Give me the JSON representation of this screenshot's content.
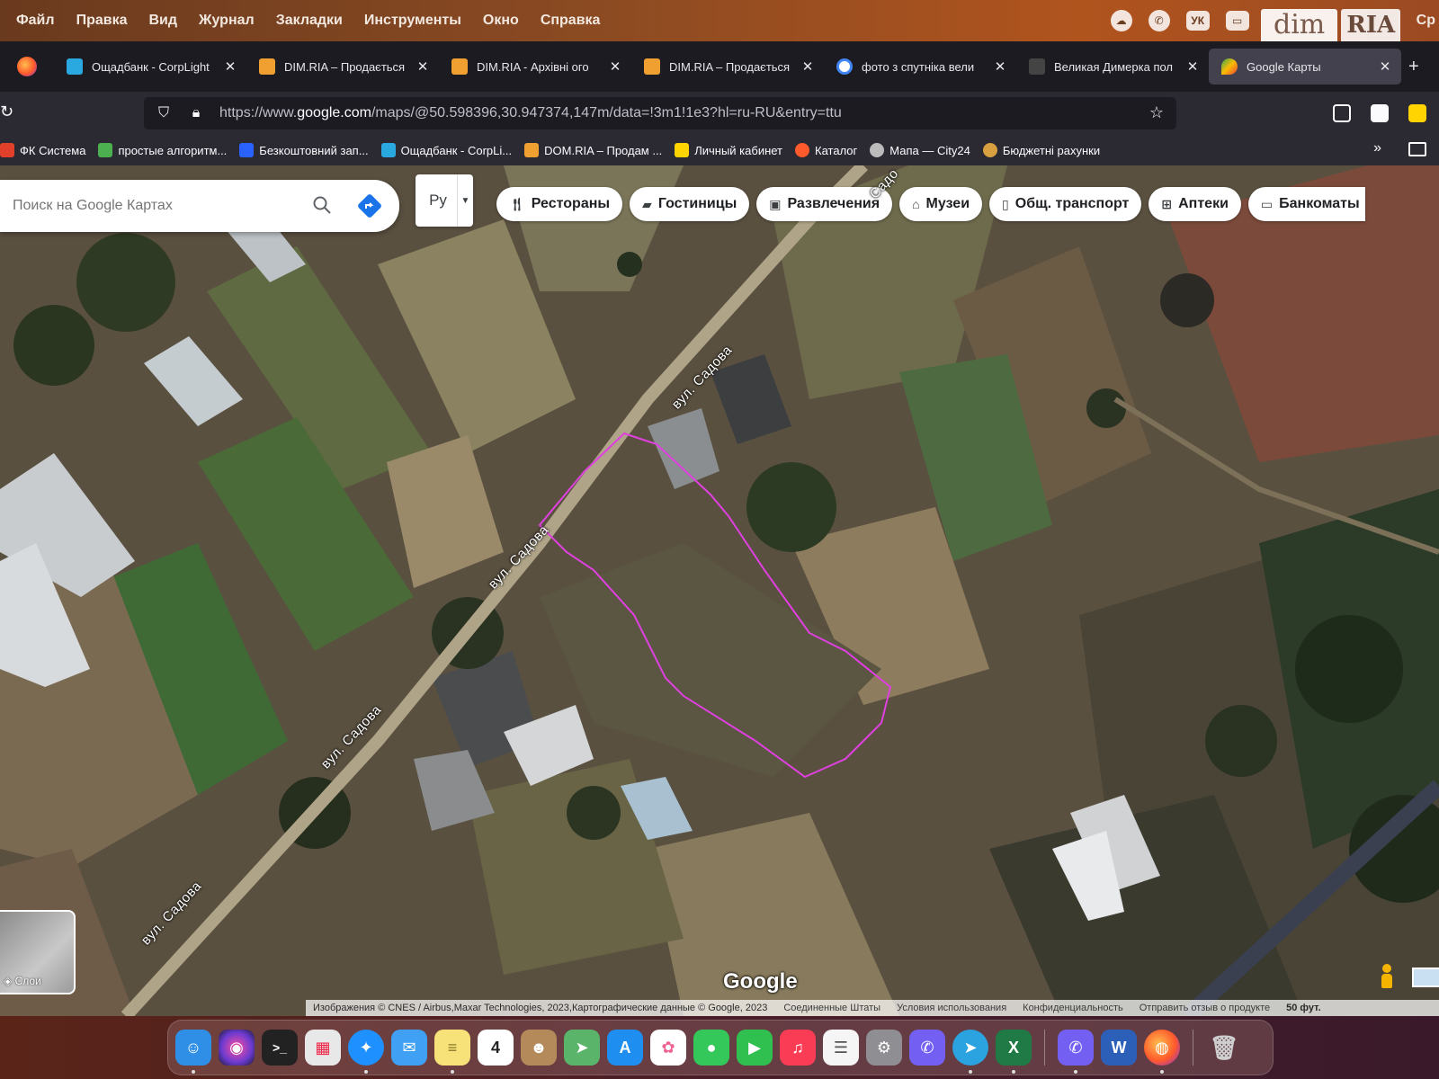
{
  "menubar": {
    "items": [
      "Файл",
      "Правка",
      "Вид",
      "Журнал",
      "Закладки",
      "Инструменты",
      "Окно",
      "Справка"
    ],
    "input_indicator": "УК",
    "clock": "Ср",
    "watermark": "dim RIA"
  },
  "tabs": [
    {
      "title": "Ощадбанк - CorpLight",
      "favicon_color": "#2aa8e0",
      "icon": "oschadbank-icon"
    },
    {
      "title": "DIM.RIA – Продається",
      "favicon_color": "#f0a030",
      "icon": "dimria-icon"
    },
    {
      "title": "DIM.RIA - Архівні ого",
      "favicon_color": "#f0a030",
      "icon": "dimria-icon"
    },
    {
      "title": "DIM.RIA – Продається",
      "favicon_color": "#f0a030",
      "icon": "dimria-icon"
    },
    {
      "title": "фото з спутніка вели",
      "favicon_color": "#ffffff",
      "icon": "google-icon"
    },
    {
      "title": "Великая Димерка пол",
      "favicon_color": "#444444",
      "icon": "building-icon"
    },
    {
      "title": "Google Карты",
      "favicon_color": "#34a853",
      "icon": "google-maps-icon",
      "active": true
    }
  ],
  "urlbar": {
    "url_prefix": "https://www.",
    "url_domain": "google.com",
    "url_rest": "/maps/@50.598396,30.947374,147m/data=!3m1!1e3?hl=ru-RU&entry=ttu"
  },
  "bookmarks": [
    {
      "label": "ФК Система",
      "color": "#e2402b"
    },
    {
      "label": "простые алгоритм...",
      "color": "#4caf50"
    },
    {
      "label": "Безкоштовний зап...",
      "color": "#2962ff"
    },
    {
      "label": "Ощадбанк - CorpLi...",
      "color": "#2aa8e0"
    },
    {
      "label": "DOM.RIA – Продам ...",
      "color": "#f0a030"
    },
    {
      "label": "Личный кабинет",
      "color": "#ffd400"
    },
    {
      "label": "Каталог",
      "color": "#ff5a2b"
    },
    {
      "label": "Мапа — City24",
      "color": "#bbbbbb"
    },
    {
      "label": "Бюджетні рахунки",
      "color": "#d8a040"
    }
  ],
  "maps": {
    "search_placeholder": "Поиск на Google Картах",
    "lang_button": "Ру",
    "chips": [
      {
        "label": "Рестораны",
        "icon": "restaurant-icon"
      },
      {
        "label": "Гостиницы",
        "icon": "hotel-icon"
      },
      {
        "label": "Развлечения",
        "icon": "ticket-icon"
      },
      {
        "label": "Музеи",
        "icon": "museum-icon"
      },
      {
        "label": "Общ. транспорт",
        "icon": "transit-icon"
      },
      {
        "label": "Аптеки",
        "icon": "pharmacy-icon"
      },
      {
        "label": "Банкоматы",
        "icon": "atm-icon"
      }
    ],
    "street_labels": [
      "вул. Садова",
      "вул. Садова",
      "вул. Садова",
      "вул. Садова",
      "Садо"
    ],
    "layers_label": "Слои",
    "google_logo": "Google",
    "attribution": "Изображения © CNES / Airbus,Maxar Technologies, 2023,Картографические данные © Google, 2023",
    "footer_links": [
      "Соединенные Штаты",
      "Условия использования",
      "Конфиденциальность",
      "Отправить отзыв о продукте"
    ],
    "scale": "50 фут. ",
    "boundary_color": "#e040e0"
  },
  "dock": {
    "apps": [
      {
        "name": "finder-icon",
        "color": "#2f8fe6",
        "glyph": "☺"
      },
      {
        "name": "siri-icon",
        "color": "#6a3ad0",
        "glyph": "◉"
      },
      {
        "name": "terminal-icon",
        "color": "#222222",
        "glyph": ">_"
      },
      {
        "name": "launchpad-icon",
        "color": "#e8e8e8",
        "glyph": "▦"
      },
      {
        "name": "safari-icon",
        "color": "#1e90ff",
        "glyph": "✦"
      },
      {
        "name": "mail-icon",
        "color": "#3fa0f4",
        "glyph": "✉"
      },
      {
        "name": "notes-icon",
        "color": "#f7e27a",
        "glyph": "≡"
      },
      {
        "name": "calendar-icon",
        "color": "#ffffff",
        "glyph": "4"
      },
      {
        "name": "contacts-icon",
        "color": "#b58a5a",
        "glyph": "☻"
      },
      {
        "name": "maps-icon",
        "color": "#5ab46a",
        "glyph": "➤"
      },
      {
        "name": "appstore-icon",
        "color": "#1f8ef1",
        "glyph": "A"
      },
      {
        "name": "photos-icon",
        "color": "#f06292",
        "glyph": "✿"
      },
      {
        "name": "messages-icon",
        "color": "#34c759",
        "glyph": "●"
      },
      {
        "name": "facetime-icon",
        "color": "#30c050",
        "glyph": "▶"
      },
      {
        "name": "music-icon",
        "color": "#fa3c55",
        "glyph": "♫"
      },
      {
        "name": "reminders-icon",
        "color": "#f5f5f5",
        "glyph": "☰"
      },
      {
        "name": "settings-icon",
        "color": "#8e8e93",
        "glyph": "⚙"
      },
      {
        "name": "viber-icon",
        "color": "#7360f2",
        "glyph": "✆"
      },
      {
        "name": "telegram-icon",
        "color": "#2aa3e0",
        "glyph": "➤"
      },
      {
        "name": "excel-icon",
        "color": "#1f7a45",
        "glyph": "X"
      }
    ],
    "recent": [
      {
        "name": "viber-icon",
        "color": "#7360f2",
        "glyph": "✆"
      },
      {
        "name": "word-icon",
        "color": "#2b5fb8",
        "glyph": "W"
      },
      {
        "name": "firefox-icon",
        "color": "#ff7139",
        "glyph": "◍"
      }
    ],
    "trash": {
      "name": "trash-icon",
      "color": "#cfcfcf",
      "glyph": "🗑"
    }
  }
}
